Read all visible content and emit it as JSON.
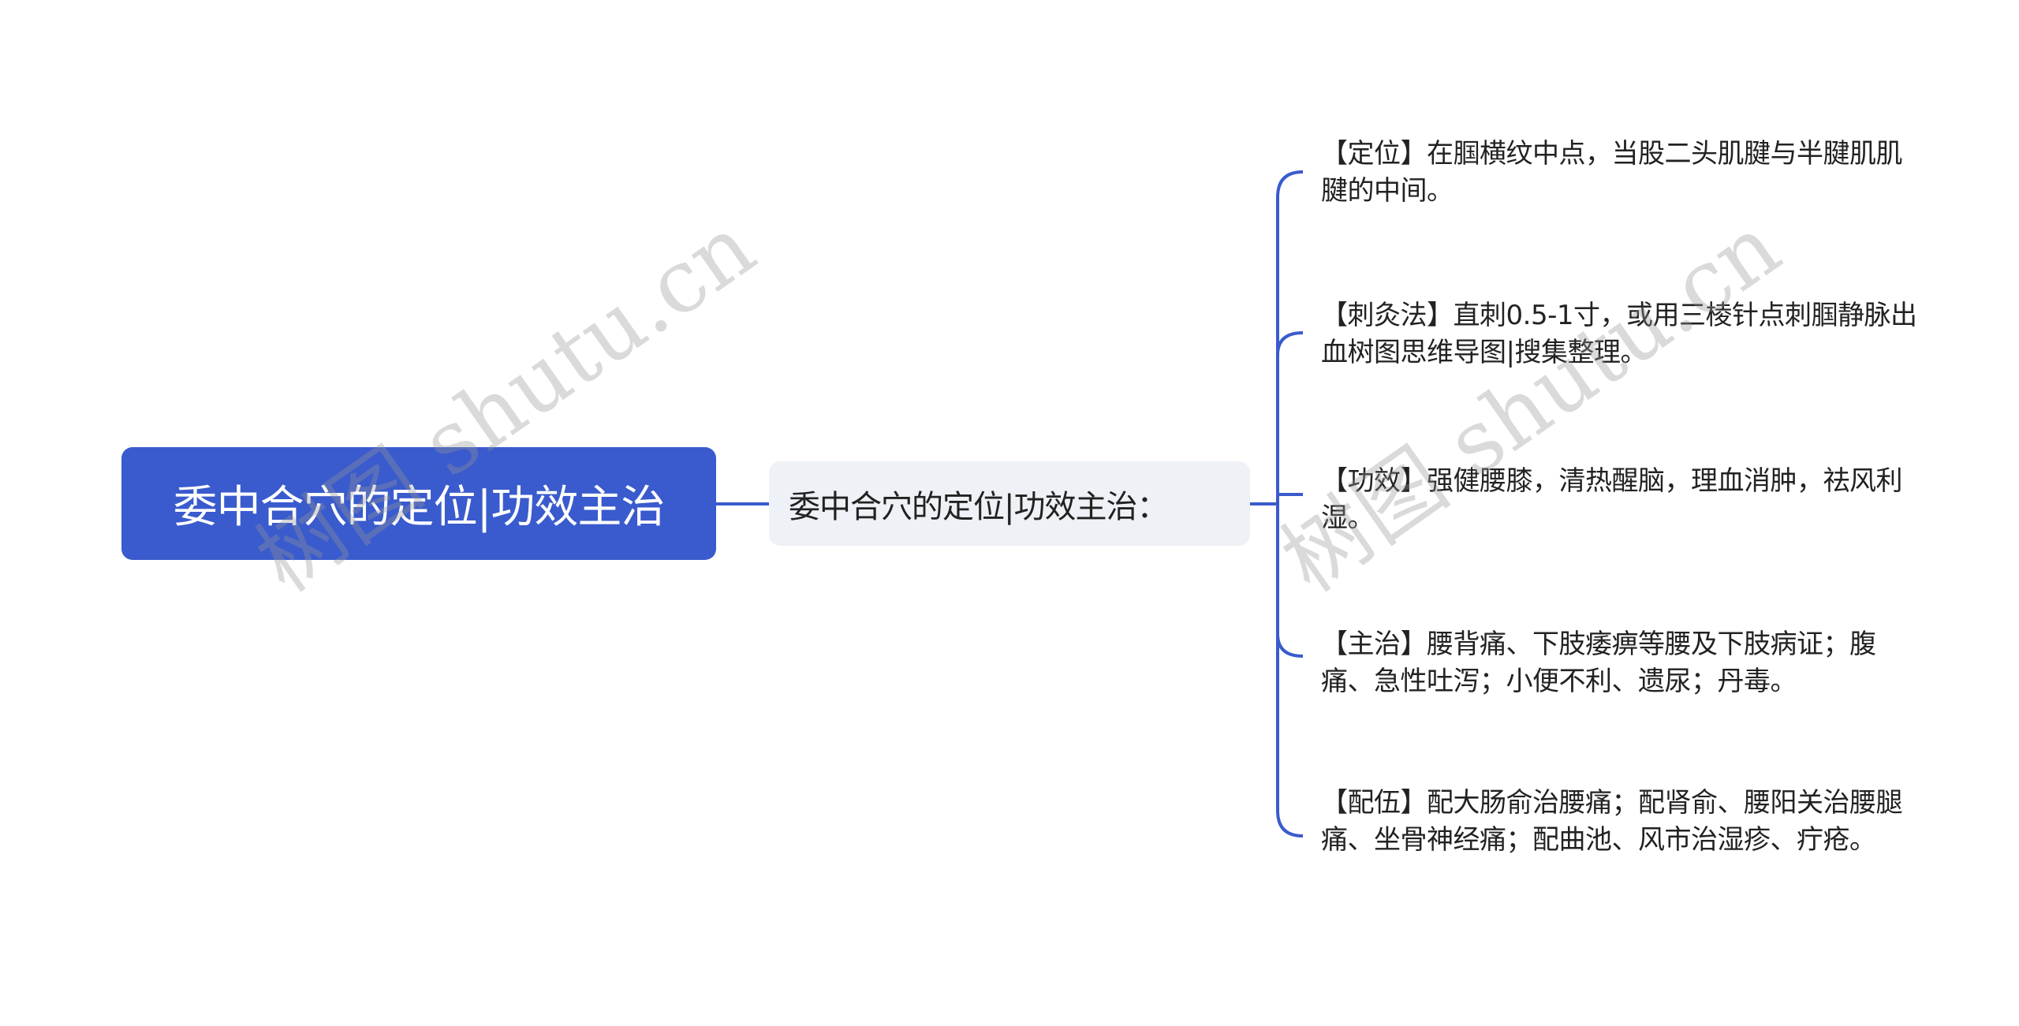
{
  "mindmap": {
    "root": {
      "label": "委中合穴的定位|功效主治",
      "color": "#3a5bcd"
    },
    "center": {
      "label": "委中合穴的定位|功效主治："
    },
    "line_color": "#3a5bcd",
    "leaves": [
      {
        "label": "【定位】在腘横纹中点，当股二头肌腱与半腱肌肌腱的中间。"
      },
      {
        "label": "【刺灸法】直刺0.5-1寸，或用三棱针点刺腘静脉出血树图思维导图|搜集整理。"
      },
      {
        "label": "【功效】强健腰膝，清热醒脑，理血消肿，祛风利湿。"
      },
      {
        "label": "【主治】腰背痛、下肢痿痹等腰及下肢病证；腹痛、急性吐泻；小便不利、遗尿；丹毒。"
      },
      {
        "label": "【配伍】配大肠俞治腰痛；配肾俞、腰阳关治腰腿痛、坐骨神经痛；配曲池、风市治湿疹、疔疮。"
      }
    ]
  },
  "watermarks": [
    {
      "text": "树图 shutu.cn"
    },
    {
      "text": "树图 shutu.cn"
    }
  ]
}
